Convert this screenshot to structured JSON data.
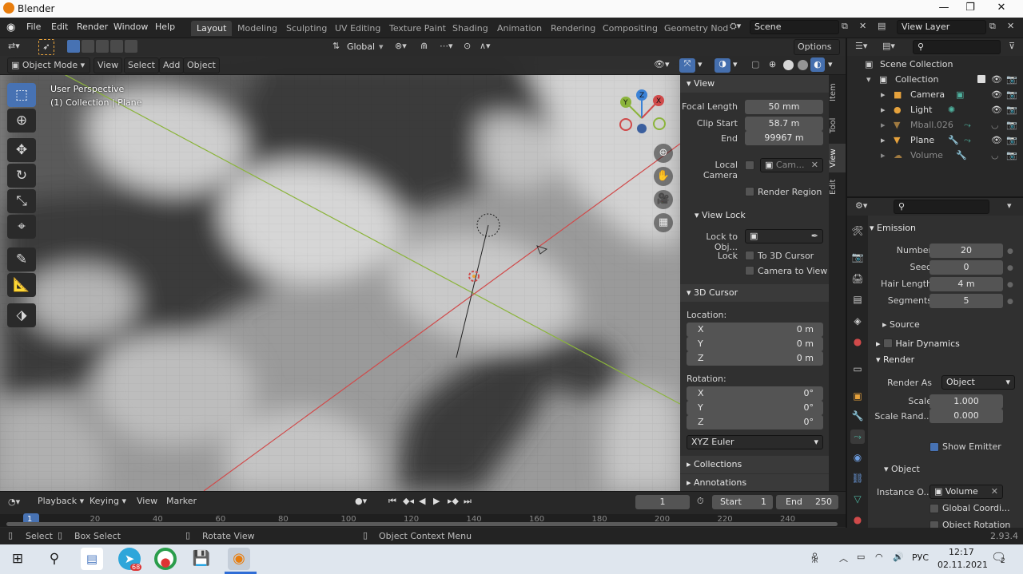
{
  "window": {
    "title": "Blender",
    "controls": [
      "—",
      "❐",
      "✕"
    ]
  },
  "topbar": {
    "menus": [
      "File",
      "Edit",
      "Render",
      "Window",
      "Help"
    ],
    "workspaces": [
      "Layout",
      "Modeling",
      "Sculpting",
      "UV Editing",
      "Texture Paint",
      "Shading",
      "Animation",
      "Rendering",
      "Compositing",
      "Geometry Nod"
    ],
    "active_workspace": "Layout",
    "scene": "Scene",
    "view_layer": "View Layer"
  },
  "viewport_header": {
    "mode": "Object Mode",
    "menus": [
      "View",
      "Select",
      "Add",
      "Object"
    ],
    "transform_orientation": "Global",
    "options": "Options"
  },
  "viewport": {
    "info_line1": "User Perspective",
    "info_line2": "(1) Collection | Plane",
    "gizmo_axes": [
      "X",
      "Y",
      "Z"
    ]
  },
  "npanel": {
    "tabs": [
      "Item",
      "Tool",
      "View",
      "Edit"
    ],
    "active_tab": "View",
    "view_title": "View",
    "focal_length_label": "Focal Length",
    "focal_length": "50 mm",
    "clip_start_label": "Clip Start",
    "clip_start": "58.7 m",
    "clip_end_label": "End",
    "clip_end": "99967 m",
    "local_camera_label": "Local Camera",
    "local_camera_value": "Cam...",
    "render_region_label": "Render Region",
    "view_lock_title": "View Lock",
    "lock_to_object_label": "Lock to Obj...",
    "lock_label": "Lock",
    "to_3d_cursor_label": "To 3D Cursor",
    "camera_to_view_label": "Camera to View",
    "cursor_title": "3D Cursor",
    "location_label": "Location:",
    "loc_x_label": "X",
    "loc_x": "0 m",
    "loc_y_label": "Y",
    "loc_y": "0 m",
    "loc_z_label": "Z",
    "loc_z": "0 m",
    "rotation_label": "Rotation:",
    "rot_x_label": "X",
    "rot_x": "0°",
    "rot_y_label": "Y",
    "rot_y": "0°",
    "rot_z_label": "Z",
    "rot_z": "0°",
    "rotation_mode": "XYZ Euler",
    "collections_title": "Collections",
    "annotations_title": "Annotations"
  },
  "outliner": {
    "scene_collection": "Scene Collection",
    "items": [
      {
        "name": "Collection",
        "level": 1
      },
      {
        "name": "Camera",
        "level": 2
      },
      {
        "name": "Light",
        "level": 2
      },
      {
        "name": "Mball.026",
        "level": 2,
        "dimmed": true
      },
      {
        "name": "Plane",
        "level": 2
      },
      {
        "name": "Volume",
        "level": 2,
        "dimmed": true
      }
    ]
  },
  "properties": {
    "emission_title": "Emission",
    "number_label": "Number",
    "number": "20",
    "seed_label": "Seed",
    "seed": "0",
    "hair_length_label": "Hair Length",
    "hair_length": "4 m",
    "segments_label": "Segments",
    "segments": "5",
    "source_title": "Source",
    "hair_dynamics_title": "Hair Dynamics",
    "render_title": "Render",
    "render_as_label": "Render As",
    "render_as": "Object",
    "scale_label": "Scale",
    "scale": "1.000",
    "scale_random_label": "Scale Rand...",
    "scale_random": "0.000",
    "show_emitter_label": "Show Emitter",
    "object_title": "Object",
    "instance_object_label": "Instance O...",
    "instance_object": "Volume",
    "global_coords_label": "Global Coordi...",
    "object_rotation_label": "Object Rotation"
  },
  "timeline": {
    "menus": [
      "Playback",
      "Keying",
      "View",
      "Marker"
    ],
    "current_frame": "1",
    "start_label": "Start",
    "start": "1",
    "end_label": "End",
    "end": "250",
    "ruler": [
      "1",
      "20",
      "40",
      "60",
      "80",
      "100",
      "120",
      "140",
      "160",
      "180",
      "200",
      "220",
      "240"
    ]
  },
  "statusbar": {
    "select": "Select",
    "box_select": "Box Select",
    "rotate_view": "Rotate View",
    "context_menu": "Object Context Menu",
    "version": "2.93.4"
  },
  "taskbar": {
    "language": "РУС",
    "time": "12:17",
    "date": "02.11.2021",
    "notifications": "2",
    "telegram_badge": "68"
  },
  "colors": {
    "accent": "#4772b3",
    "x_axis": "#d04a4a",
    "y_axis": "#8bb43b",
    "z_axis": "#3b82d6"
  }
}
